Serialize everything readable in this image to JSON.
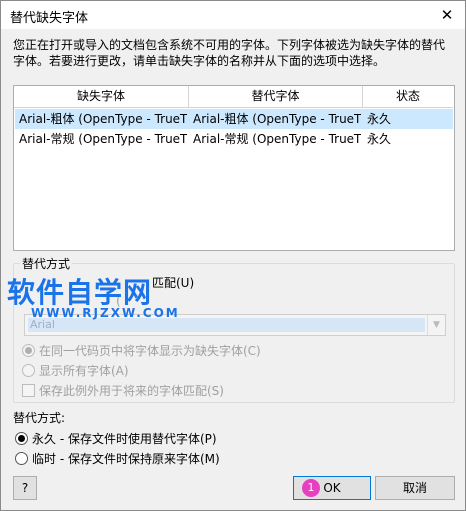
{
  "window": {
    "title": "替代缺失字体",
    "close_glyph": "✕"
  },
  "description": "您正在打开或导入的文档包含系统不可用的字体。下列字体被选为缺失字体的替代字体。若要进行更改，请单击缺失字体的名称并从下面的选项中选择。",
  "table": {
    "headers": [
      "缺失字体",
      "替代字体",
      "状态"
    ],
    "rows": [
      {
        "missing": "Arial-粗体 (OpenType - TrueT...",
        "substitute": "Arial-粗体 (OpenType - TrueT...",
        "status": "永久",
        "selected": true
      },
      {
        "missing": "Arial-常规 (OpenType - TrueT...",
        "substitute": "Arial-常规 (OpenType - TrueT...",
        "status": "永久",
        "selected": false
      }
    ]
  },
  "substitution_group": {
    "legend": "替代方式",
    "match_fragment": "匹配(U)",
    "partial_label": "(",
    "combo_value": "Arial",
    "option_same_codepage": "在同一代码页中将字体显示为缺失字体(C)",
    "option_show_all": "显示所有字体(A)",
    "option_keep_exceptions": "保存此例外用于将来的字体匹配(S)"
  },
  "watermark": {
    "text": "软件自学网",
    "url": "WWW.RJZXW.COM"
  },
  "mode": {
    "label": "替代方式:",
    "permanent": "永久 - 保存文件时使用替代字体(P)",
    "temporary": "临时 - 保存文件时保持原来字体(M)"
  },
  "buttons": {
    "help": "?",
    "ok": "OK",
    "cancel": "取消",
    "ok_badge": "1"
  },
  "colors": {
    "selection": "#cce8ff",
    "watermark": "#1a73e8",
    "badge": "#e83fc0",
    "default_border": "#0078d7"
  }
}
